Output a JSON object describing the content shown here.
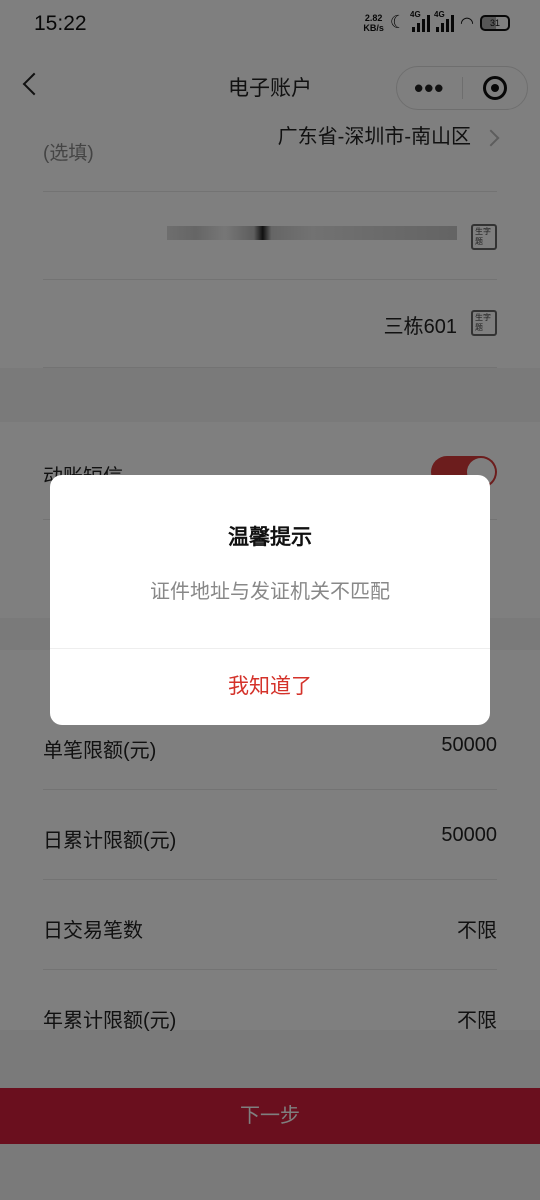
{
  "status_bar": {
    "time": "15:22",
    "net_speed_value": "2.82",
    "net_speed_unit": "KB/s",
    "signal1_tag": "4G",
    "signal2_tag": "4G",
    "battery": "31",
    "icons": [
      "moon-icon",
      "signal-icon",
      "signal-icon",
      "wifi-icon",
      "battery-icon"
    ]
  },
  "nav": {
    "title": "电子账户",
    "back_icon": "chevron-left-icon",
    "more_icon": "more-dots-icon",
    "close_icon": "target-icon"
  },
  "form_top": {
    "address_label_line2": "(选填)",
    "region_value": "广东省-深圳市-南山区",
    "street_value": "三栋601",
    "ocr_icon_text": "生字\n题"
  },
  "form_mid": {
    "sms_label": "动账短信"
  },
  "limits": {
    "rows": [
      {
        "label": "单笔限额(元)",
        "value": "50000"
      },
      {
        "label": "日累计限额(元)",
        "value": "50000"
      },
      {
        "label": "日交易笔数",
        "value": "不限"
      },
      {
        "label": "年累计限额(元)",
        "value": "不限"
      }
    ]
  },
  "next_button": "下一步",
  "dialog": {
    "title": "温馨提示",
    "message": "证件地址与发证机关不匹配",
    "button": "我知道了"
  },
  "colors": {
    "accent_red": "#d41e3c",
    "dialog_button": "#d4322a",
    "toggle_on": "#d93a3a"
  }
}
